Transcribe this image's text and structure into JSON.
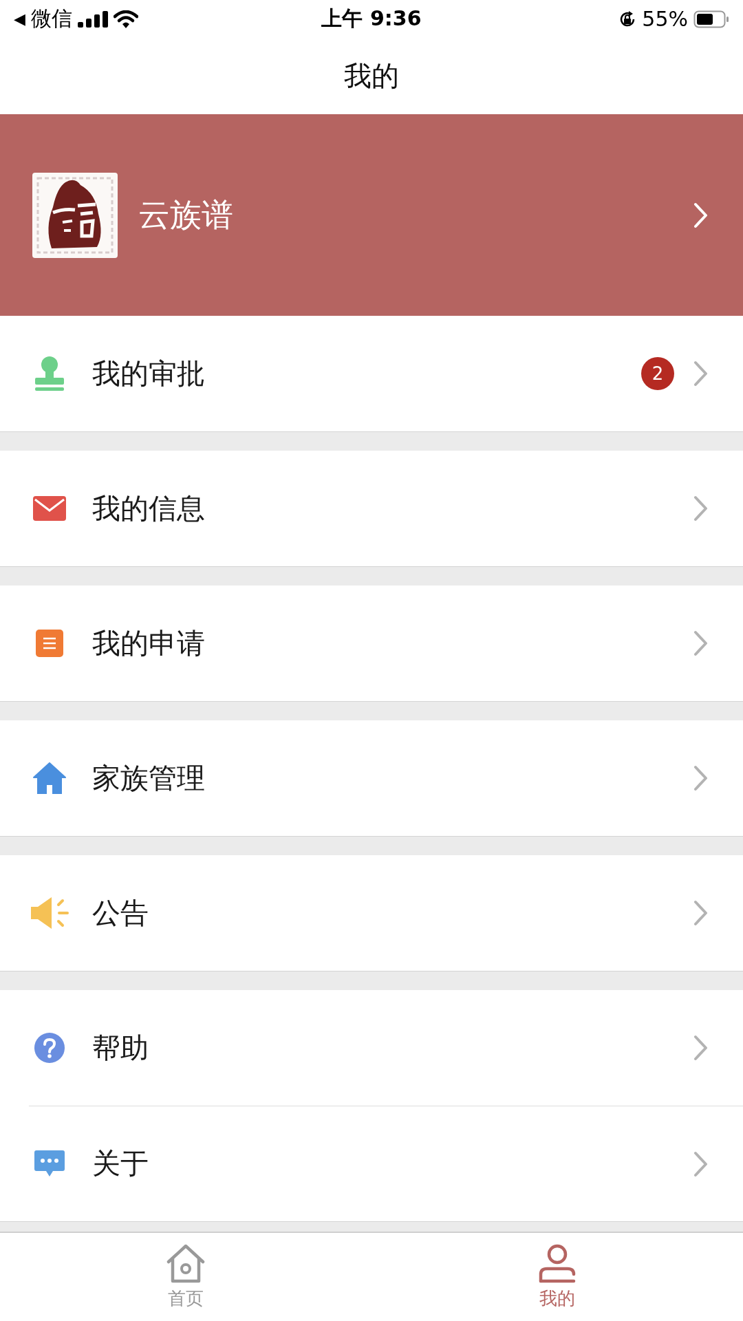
{
  "status_bar": {
    "back": "◀",
    "app": "微信",
    "time": "上午 9:36",
    "battery": "55%"
  },
  "header": {
    "title": "我的"
  },
  "profile": {
    "name": "云族谱"
  },
  "menu_groups": [
    {
      "items": [
        {
          "label": "我的审批",
          "badge": "2"
        }
      ]
    },
    {
      "items": [
        {
          "label": "我的信息"
        }
      ]
    },
    {
      "items": [
        {
          "label": "我的申请"
        }
      ]
    },
    {
      "items": [
        {
          "label": "家族管理"
        }
      ]
    },
    {
      "items": [
        {
          "label": "公告"
        }
      ]
    },
    {
      "items": [
        {
          "label": "帮助"
        },
        {
          "label": "关于"
        }
      ]
    }
  ],
  "tabs": [
    {
      "label": "首页",
      "selected": false
    },
    {
      "label": "我的",
      "selected": true
    }
  ]
}
